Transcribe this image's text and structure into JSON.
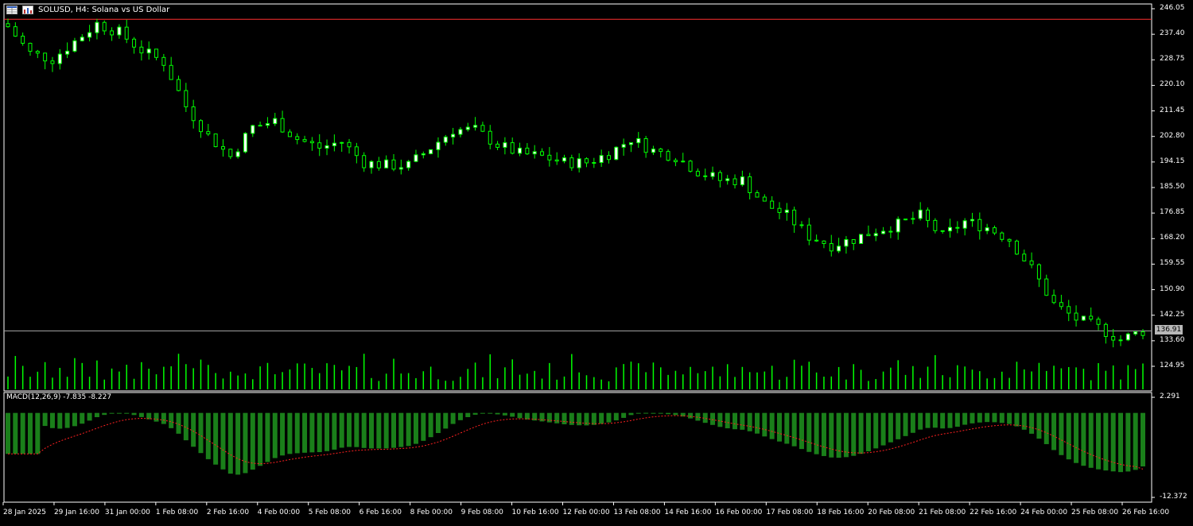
{
  "header": {
    "title": "SOLUSD, H4:  Solana vs US Dollar",
    "icons": [
      "table-icon",
      "chart-icon"
    ]
  },
  "colors": {
    "background": "#000000",
    "bull_candle": "#ffffff",
    "bear_candle": "#000000",
    "candle_outline": "#00ff00",
    "volume": "#00ff00",
    "macd_hist": "#1a7f1a",
    "macd_signal": "#ff2020",
    "ask_line": "#ff3030",
    "bid_line": "#a0a0a0",
    "axis": "#ffffff"
  },
  "macd": {
    "label": "MACD(12,26,9) -7.835 -8.227",
    "ticks": [
      "2.291",
      "-12.372"
    ]
  },
  "chart_data": {
    "type": "candlestick",
    "symbol": "SOLUSD",
    "timeframe": "H4",
    "price_ticks": [
      "246.05",
      "237.40",
      "228.75",
      "220.10",
      "211.45",
      "202.80",
      "194.15",
      "185.50",
      "176.85",
      "168.20",
      "159.55",
      "150.90",
      "142.25",
      "133.60",
      "124.95"
    ],
    "last_price": "136.91",
    "ask_level": 242.5,
    "bid_level": 136.91,
    "x_labels": [
      "28 Jan 2025",
      "29 Jan 16:00",
      "31 Jan 00:00",
      "1 Feb 08:00",
      "2 Feb 16:00",
      "4 Feb 00:00",
      "5 Feb 08:00",
      "6 Feb 16:00",
      "8 Feb 00:00",
      "9 Feb 08:00",
      "10 Feb 16:00",
      "12 Feb 00:00",
      "13 Feb 08:00",
      "14 Feb 16:00",
      "16 Feb 00:00",
      "17 Feb 08:00",
      "18 Feb 16:00",
      "20 Feb 08:00",
      "21 Feb 08:00",
      "22 Feb 16:00",
      "24 Feb 00:00",
      "25 Feb 08:00",
      "26 Feb 16:00"
    ],
    "close_path": [
      [
        0,
        240
      ],
      [
        3,
        231
      ],
      [
        6,
        229
      ],
      [
        9,
        235
      ],
      [
        12,
        241
      ],
      [
        15,
        238
      ],
      [
        18,
        232
      ],
      [
        21,
        228
      ],
      [
        24,
        213
      ],
      [
        27,
        203
      ],
      [
        30,
        196
      ],
      [
        33,
        206
      ],
      [
        36,
        208
      ],
      [
        39,
        202
      ],
      [
        42,
        199
      ],
      [
        45,
        201
      ],
      [
        48,
        194
      ],
      [
        51,
        193
      ],
      [
        54,
        193
      ],
      [
        57,
        199
      ],
      [
        60,
        205
      ],
      [
        63,
        205
      ],
      [
        66,
        200
      ],
      [
        69,
        197
      ],
      [
        72,
        196
      ],
      [
        75,
        194
      ],
      [
        78,
        194
      ],
      [
        81,
        197
      ],
      [
        84,
        202
      ],
      [
        87,
        198
      ],
      [
        90,
        196
      ],
      [
        93,
        191
      ],
      [
        96,
        188
      ],
      [
        99,
        188
      ],
      [
        102,
        180
      ],
      [
        105,
        176
      ],
      [
        108,
        169
      ],
      [
        111,
        166
      ],
      [
        114,
        168
      ],
      [
        117,
        171
      ],
      [
        120,
        173
      ],
      [
        123,
        176
      ],
      [
        126,
        169
      ],
      [
        129,
        174
      ],
      [
        132,
        172
      ],
      [
        135,
        168
      ],
      [
        138,
        158
      ],
      [
        141,
        146
      ],
      [
        144,
        141
      ],
      [
        147,
        138
      ],
      [
        150,
        134
      ],
      [
        153,
        136.91
      ]
    ],
    "volume_range": [
      0,
      100
    ],
    "macd_hist_range": [
      -12.372,
      2.291
    ],
    "macd_last": -7.835,
    "signal_last": -8.227
  }
}
